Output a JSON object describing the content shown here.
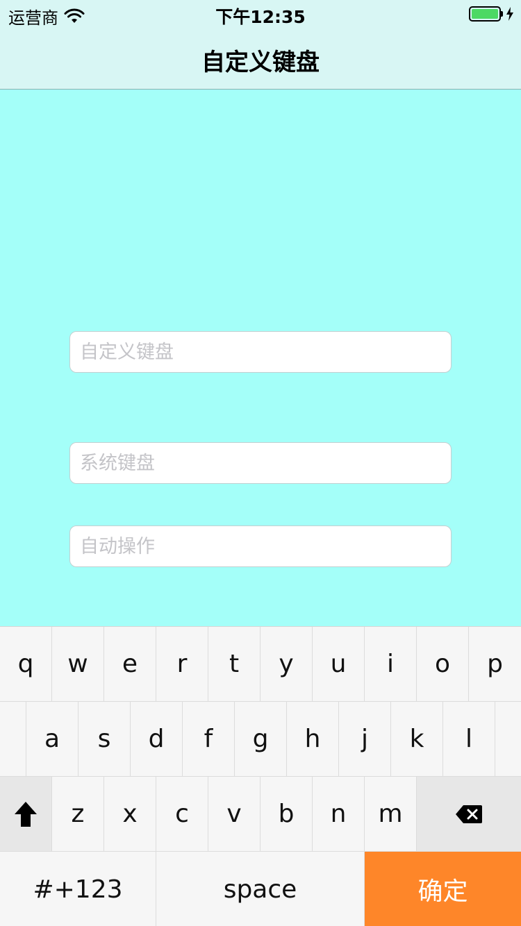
{
  "status_bar": {
    "carrier": "运营商",
    "time": "下午12:35",
    "icons": {
      "wifi": "wifi-icon",
      "battery": "battery-icon",
      "charging": "charging-bolt-icon"
    },
    "battery_level": 1.0
  },
  "nav": {
    "title": "自定义键盘"
  },
  "fields": [
    {
      "placeholder": "自定义键盘",
      "value": ""
    },
    {
      "placeholder": "系统键盘",
      "value": ""
    },
    {
      "placeholder": "自动操作",
      "value": ""
    }
  ],
  "keyboard": {
    "row1": [
      "q",
      "w",
      "e",
      "r",
      "t",
      "y",
      "u",
      "i",
      "o",
      "p"
    ],
    "row2": [
      "a",
      "s",
      "d",
      "f",
      "g",
      "h",
      "j",
      "k",
      "l"
    ],
    "row3": [
      "z",
      "x",
      "c",
      "v",
      "b",
      "n",
      "m"
    ],
    "shift_icon": "shift-arrow-icon",
    "delete_icon": "backspace-icon",
    "symbols_label": "#+123",
    "space_label": "space",
    "confirm_label": "确定"
  },
  "colors": {
    "background": "#a4fff9",
    "nav_background": "#d8f6f4",
    "confirm_key": "#fe8629",
    "battery": "#4cd964"
  }
}
